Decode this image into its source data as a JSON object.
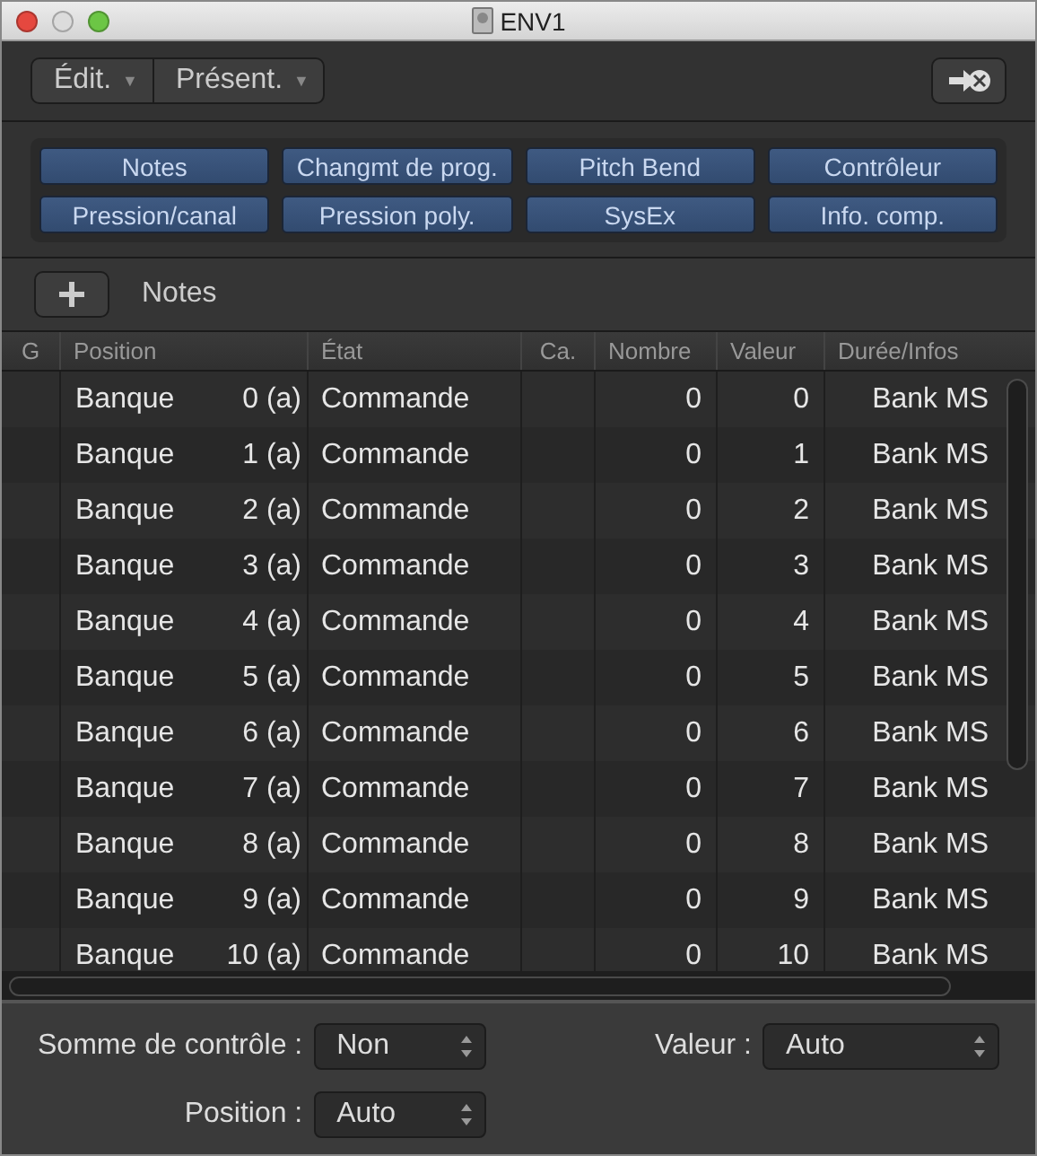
{
  "window": {
    "title": "ENV1"
  },
  "toolbar": {
    "menus": [
      {
        "label": "Édit.",
        "arrow": "▼"
      },
      {
        "label": "Présent.",
        "arrow": "▼"
      }
    ]
  },
  "filters": [
    {
      "label": "Notes"
    },
    {
      "label": "Changmt de prog."
    },
    {
      "label": "Pitch Bend"
    },
    {
      "label": "Contrôleur"
    },
    {
      "label": "Pression/canal"
    },
    {
      "label": "Pression poly."
    },
    {
      "label": "SysEx"
    },
    {
      "label": "Info. comp."
    }
  ],
  "section": {
    "title": "Notes"
  },
  "table": {
    "columns": [
      "G",
      "Position",
      "État",
      "Ca.",
      "Nombre",
      "Valeur",
      "Durée/Infos"
    ],
    "rows": [
      {
        "position": "Banque",
        "position_number": "0 (a)",
        "state": "Commande",
        "channel": "",
        "number": "0",
        "value": "0",
        "info": "Bank MS"
      },
      {
        "position": "Banque",
        "position_number": "1 (a)",
        "state": "Commande",
        "channel": "",
        "number": "0",
        "value": "1",
        "info": "Bank MS"
      },
      {
        "position": "Banque",
        "position_number": "2 (a)",
        "state": "Commande",
        "channel": "",
        "number": "0",
        "value": "2",
        "info": "Bank MS"
      },
      {
        "position": "Banque",
        "position_number": "3 (a)",
        "state": "Commande",
        "channel": "",
        "number": "0",
        "value": "3",
        "info": "Bank MS"
      },
      {
        "position": "Banque",
        "position_number": "4 (a)",
        "state": "Commande",
        "channel": "",
        "number": "0",
        "value": "4",
        "info": "Bank MS"
      },
      {
        "position": "Banque",
        "position_number": "5 (a)",
        "state": "Commande",
        "channel": "",
        "number": "0",
        "value": "5",
        "info": "Bank MS"
      },
      {
        "position": "Banque",
        "position_number": "6 (a)",
        "state": "Commande",
        "channel": "",
        "number": "0",
        "value": "6",
        "info": "Bank MS"
      },
      {
        "position": "Banque",
        "position_number": "7 (a)",
        "state": "Commande",
        "channel": "",
        "number": "0",
        "value": "7",
        "info": "Bank MS"
      },
      {
        "position": "Banque",
        "position_number": "8 (a)",
        "state": "Commande",
        "channel": "",
        "number": "0",
        "value": "8",
        "info": "Bank MS"
      },
      {
        "position": "Banque",
        "position_number": "9 (a)",
        "state": "Commande",
        "channel": "",
        "number": "0",
        "value": "9",
        "info": "Bank MS"
      },
      {
        "position": "Banque",
        "position_number": "10 (a)",
        "state": "Commande",
        "channel": "",
        "number": "0",
        "value": "10",
        "info": "Bank MS"
      }
    ]
  },
  "settings": {
    "checksum": {
      "label": "Somme de contrôle :",
      "value": "Non"
    },
    "value": {
      "label": "Valeur :",
      "value": "Auto"
    },
    "position": {
      "label": "Position :",
      "value": "Auto"
    }
  }
}
